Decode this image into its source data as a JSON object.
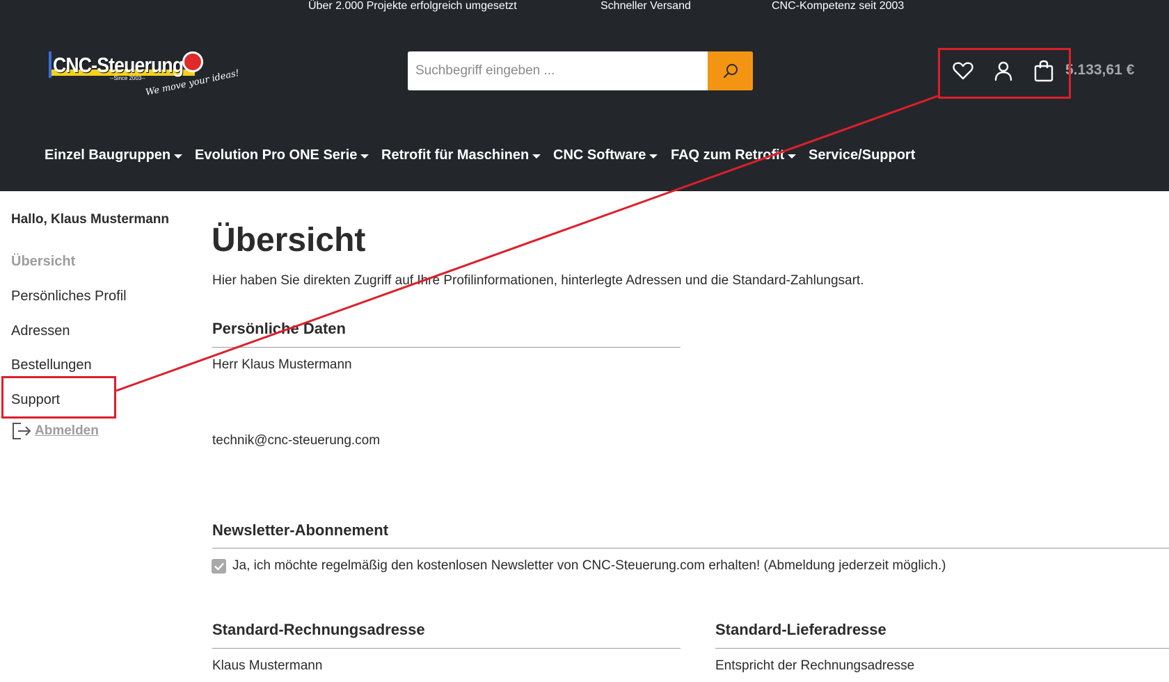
{
  "topbar": {
    "items": [
      "Über 2.000 Projekte erfolgreich umgesetzt",
      "Schneller Versand",
      "CNC-Kompetenz seit 2003"
    ]
  },
  "logo": {
    "name": "CNC-Steuerung",
    "since": "--Since 2003--",
    "tagline": "We move your ideas!"
  },
  "search": {
    "placeholder": "Suchbegriff eingeben ...",
    "icon": "search-icon"
  },
  "header_icons": [
    "heart-icon",
    "user-icon",
    "shopping-bag-icon"
  ],
  "cart": {
    "total": "5.133,61 €"
  },
  "nav": {
    "items": [
      {
        "label": "Einzel Baugruppen",
        "dropdown": true
      },
      {
        "label": "Evolution Pro ONE Serie",
        "dropdown": true
      },
      {
        "label": "Retrofit für Maschinen",
        "dropdown": true
      },
      {
        "label": "CNC Software",
        "dropdown": true
      },
      {
        "label": "FAQ zum Retrofit",
        "dropdown": true
      },
      {
        "label": "Service/Support",
        "dropdown": false
      }
    ]
  },
  "sidebar": {
    "greeting": "Hallo, Klaus Mustermann",
    "items": [
      "Übersicht",
      "Persönliches Profil",
      "Adressen",
      "Bestellungen",
      "Support"
    ],
    "active": "Übersicht",
    "logout": "Abmelden"
  },
  "main": {
    "title": "Übersicht",
    "intro": "Hier haben Sie direkten Zugriff auf Ihre Profilinformationen, hinterlegte Adressen und die Standard-Zahlungsart.",
    "personal": {
      "heading": "Persönliche Daten",
      "name": "Herr Klaus Mustermann",
      "email": "technik@cnc-steuerung.com"
    },
    "newsletter": {
      "heading": "Newsletter-Abonnement",
      "checked": true,
      "label": "Ja, ich möchte regelmäßig den kostenlosen Newsletter von CNC-Steuerung.com erhalten! (Abmeldung jederzeit möglich.)"
    },
    "billing": {
      "heading": "Standard-Rechnungsadresse",
      "name": "Klaus Mustermann"
    },
    "shipping": {
      "heading": "Standard-Lieferadresse",
      "note": "Entspricht der Rechnungsadresse"
    }
  },
  "colors": {
    "header_bg": "#23272b",
    "accent": "#f39413",
    "annotation": "#dc1f2a"
  }
}
